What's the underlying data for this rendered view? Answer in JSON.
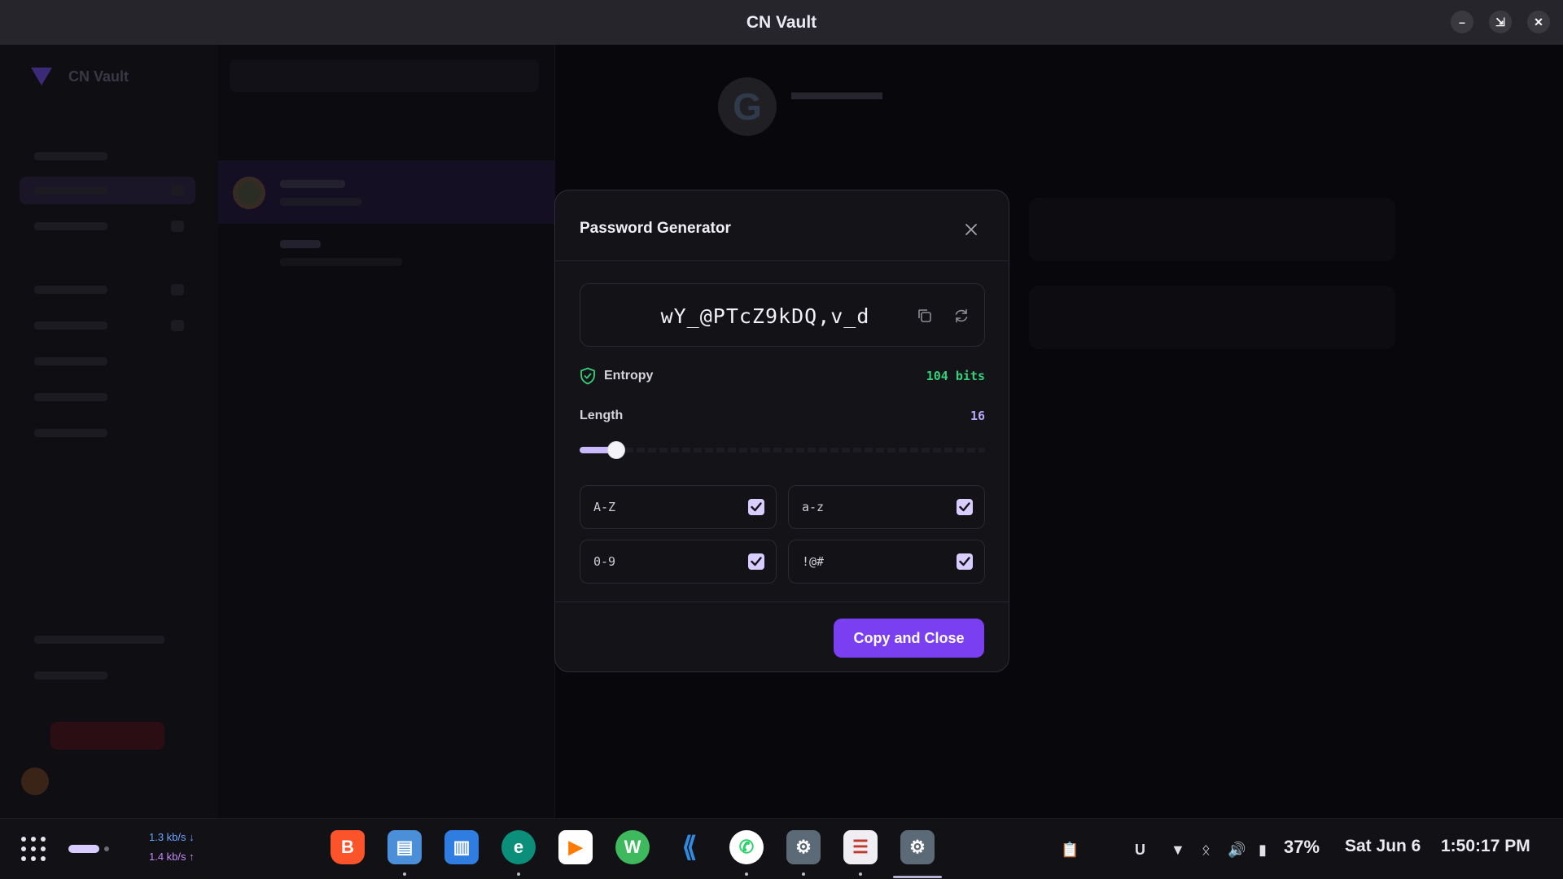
{
  "window": {
    "title": "CN Vault",
    "controls": [
      "minimize",
      "restore",
      "close"
    ]
  },
  "modal": {
    "title": "Password Generator",
    "password": "wY_@PTcZ9kDQ,v_d",
    "entropy_label": "Entropy",
    "entropy_value": "104 bits",
    "length_label": "Length",
    "length_value": "16",
    "length_fraction": 0.09,
    "options": [
      {
        "label": "A-Z",
        "checked": true
      },
      {
        "label": "a-z",
        "checked": true
      },
      {
        "label": "0-9",
        "checked": true
      },
      {
        "label": "!@#",
        "checked": true
      }
    ],
    "primary_button": "Copy and Close"
  },
  "colors": {
    "accent": "#7b3ff2",
    "entropy": "#33d17a",
    "length": "#b8a6f8",
    "checkbox": "#d9ccff"
  },
  "taskbar": {
    "net_down": "1.3 kb/s",
    "net_up": "1.4 kb/s",
    "apps": [
      "brave-icon",
      "files-icon",
      "store-icon",
      "edge-icon",
      "play-icon",
      "android-studio-icon",
      "vscode-icon",
      "whatsapp-icon",
      "settings-icon",
      "text-editor-icon",
      "settings-icon"
    ],
    "battery": "37%",
    "date": "Sat Jun 6",
    "time": "1:50:17 PM"
  }
}
